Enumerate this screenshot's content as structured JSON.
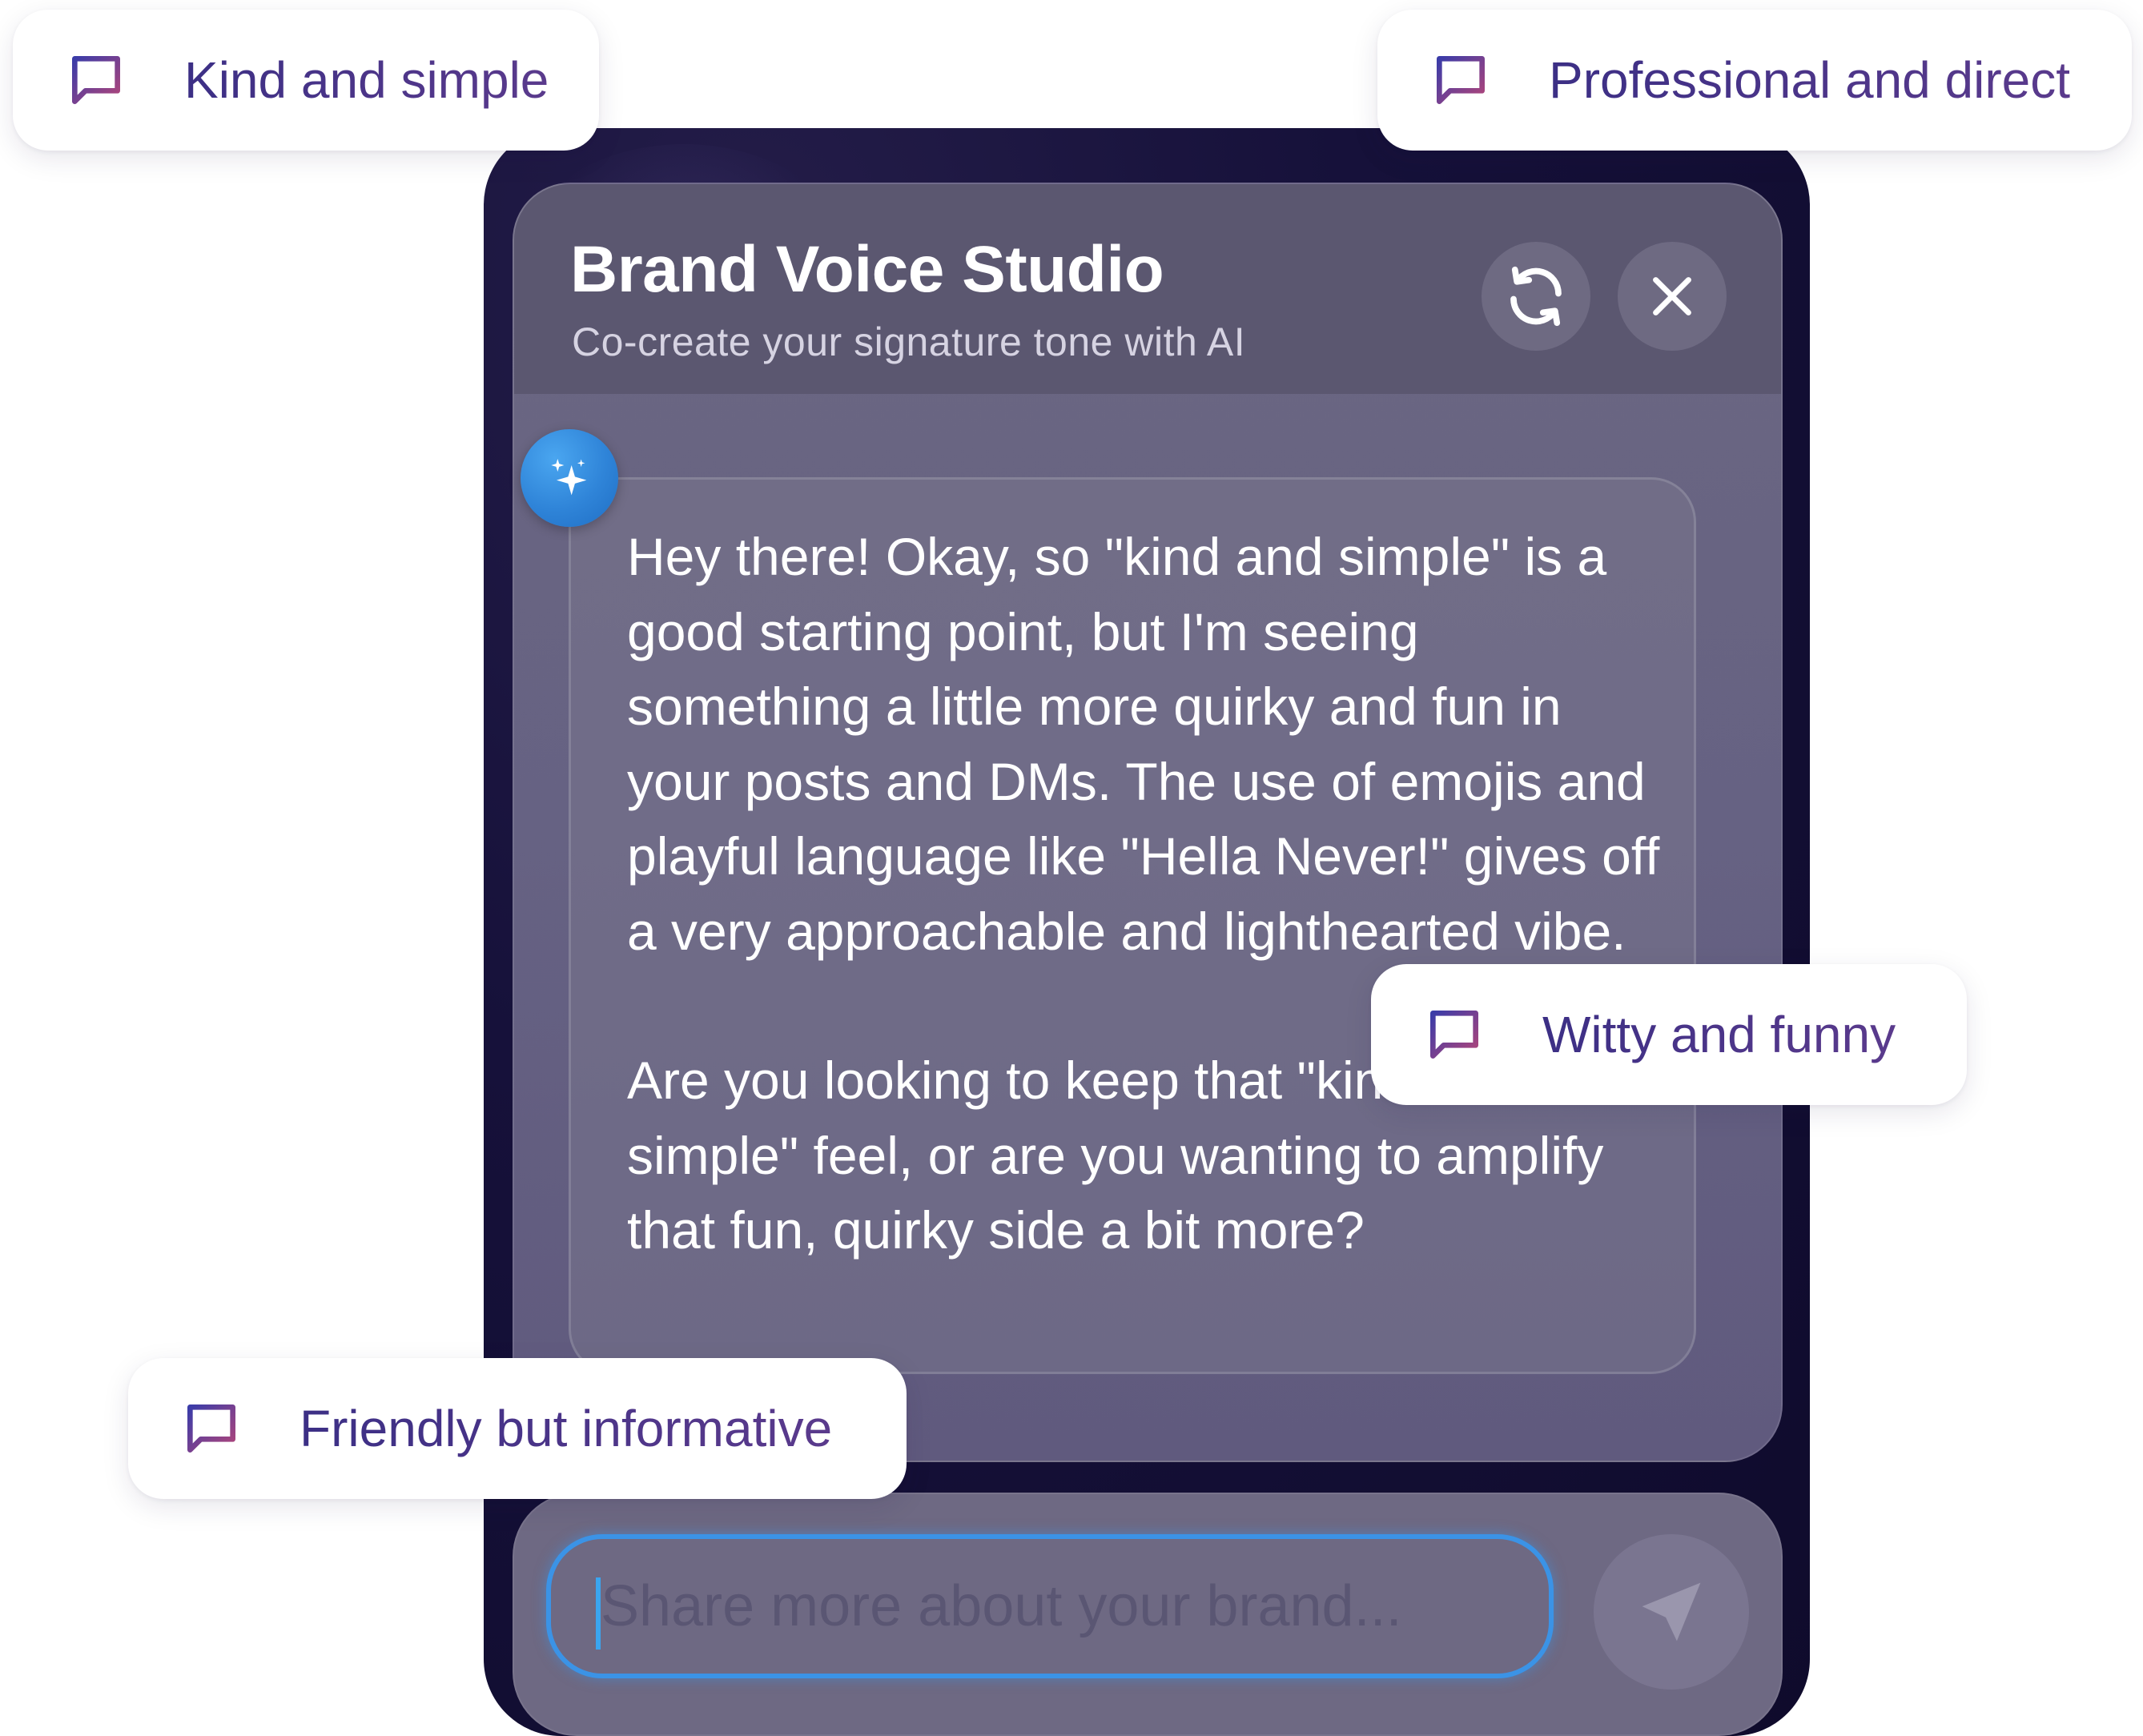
{
  "app": {
    "title": "Brand Voice Studio",
    "subtitle": "Co-create your signature tone with AI"
  },
  "header_actions": {
    "refresh_icon": "refresh-icon",
    "close_icon": "close-icon"
  },
  "message": {
    "avatar_icon": "sparkle-icon",
    "paragraphs": [
      "Hey there! Okay, so \"kind and simple\" is a good starting point, but I'm seeing something a little more quirky and fun in your posts and DMs. The use of emojis and playful language like \"Hella Never!\" gives off a very approachable and lighthearted vibe.",
      "Are you looking to keep that \"kind and simple\" feel, or are you wanting to amplify that fun, quirky side a bit more?"
    ]
  },
  "composer": {
    "placeholder": "Share more about your brand...",
    "value": "",
    "send_icon": "send-icon"
  },
  "tone_chips": [
    {
      "label": "Kind and simple",
      "icon": "chat-bubble-icon"
    },
    {
      "label": "Professional and direct",
      "icon": "chat-bubble-icon"
    },
    {
      "label": "Witty and funny",
      "icon": "chat-bubble-icon"
    },
    {
      "label": "Friendly but informative",
      "icon": "chat-bubble-icon"
    }
  ],
  "colors": {
    "accent_blue": "#3b93e6",
    "chip_text": "#3c2f85",
    "device_bg": "#16113a",
    "card_bg": "#666283"
  }
}
